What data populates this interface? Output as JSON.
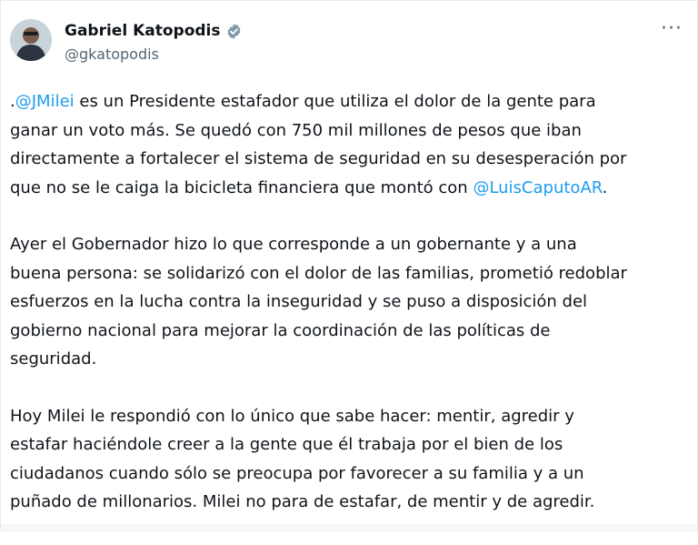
{
  "tweet": {
    "author_name": "Gabriel Katopodis",
    "author_handle": "@gkatopodis",
    "more_glyph": "···",
    "verified_color": "#829aab",
    "mention_color": "#1d9bf0",
    "paragraphs": [
      {
        "lines": [
          [
            ".",
            {
              "mention": "@JMilei"
            },
            " es un Presidente estafador que utiliza el dolor de la gente para"
          ],
          [
            "ganar un voto más. Se quedó con 750 mil millones de pesos que iban"
          ],
          [
            "directamente a fortalecer el sistema de seguridad en su desesperación por"
          ],
          [
            "que no se le caiga la bicicleta financiera que montó con ",
            {
              "mention": "@LuisCaputoAR"
            },
            "."
          ]
        ]
      },
      {
        "lines": [
          [
            "Ayer el Gobernador hizo lo que corresponde a un gobernante y a una"
          ],
          [
            "buena persona: se solidarizó con el dolor de las familias, prometió redoblar"
          ],
          [
            "esfuerzos en la lucha contra la inseguridad y se puso a disposición del"
          ],
          [
            "gobierno nacional para mejorar la coordinación de las políticas de"
          ],
          [
            "seguridad."
          ]
        ]
      },
      {
        "lines": [
          [
            "Hoy Milei le respondió con lo único que sabe hacer: mentir, agredir y"
          ],
          [
            "estafar haciéndole creer a la gente que él trabaja por el bien de los"
          ],
          [
            "ciudadanos cuando sólo se preocupa por favorecer a su familia y a un"
          ],
          [
            "puñado de millonarios. Milei no para de estafar, de mentir y de agredir."
          ]
        ]
      }
    ]
  }
}
